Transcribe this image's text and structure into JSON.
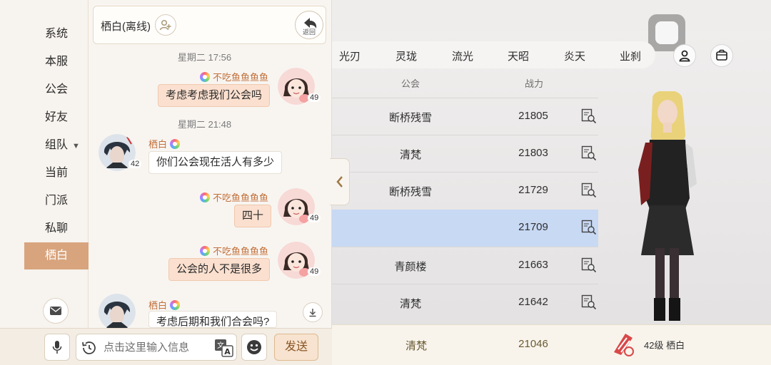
{
  "sidebar": {
    "items": [
      {
        "label": "系统"
      },
      {
        "label": "本服"
      },
      {
        "label": "公会"
      },
      {
        "label": "好友"
      },
      {
        "label": "组队"
      },
      {
        "label": "当前"
      },
      {
        "label": "门派"
      },
      {
        "label": "私聊"
      },
      {
        "label": "栖白"
      }
    ],
    "active_index": 8
  },
  "chat": {
    "title": "栖白(离线)",
    "back_label": "返回",
    "messages": [
      {
        "type": "time",
        "text": "星期二 17:56"
      },
      {
        "type": "self",
        "name": "不吃鱼鱼鱼鱼",
        "text": "考虑考虑我们公会吗",
        "level": "49"
      },
      {
        "type": "time",
        "text": "星期二 21:48"
      },
      {
        "type": "other",
        "name": "栖白",
        "text": "你们公会现在活人有多少",
        "level": "42"
      },
      {
        "type": "self",
        "name": "不吃鱼鱼鱼鱼",
        "text": "四十",
        "level": "49"
      },
      {
        "type": "self",
        "name": "不吃鱼鱼鱼鱼",
        "text": "公会的人不是很多",
        "level": "49"
      },
      {
        "type": "other",
        "name": "栖白",
        "text": "考虑后期和我们合会吗?",
        "level": "42"
      }
    ]
  },
  "input": {
    "placeholder": "点击这里输入信息",
    "send_label": "发送"
  },
  "ranking": {
    "tabs": [
      "光刃",
      "灵珑",
      "流光",
      "天昭",
      "炎天",
      "业刹"
    ],
    "headers": {
      "guild": "公会",
      "power": "战力"
    },
    "rows": [
      {
        "guild": "断桥残雪",
        "power": "21805",
        "selected": false
      },
      {
        "guild": "清梵",
        "power": "21803",
        "selected": false
      },
      {
        "guild": "断桥残雪",
        "power": "21729",
        "selected": false
      },
      {
        "guild": "",
        "power": "21709",
        "selected": true
      },
      {
        "guild": "青颜楼",
        "power": "21663",
        "selected": false
      },
      {
        "guild": "清梵",
        "power": "21642",
        "selected": false
      }
    ],
    "self": {
      "guild": "清梵",
      "power": "21046",
      "level_name": "42级 栖白"
    }
  },
  "colors": {
    "accent": "#d8a47d",
    "self_bubble": "#fbe0cf",
    "name_color": "#c2703a",
    "selected_row": "#c8d9f4"
  }
}
